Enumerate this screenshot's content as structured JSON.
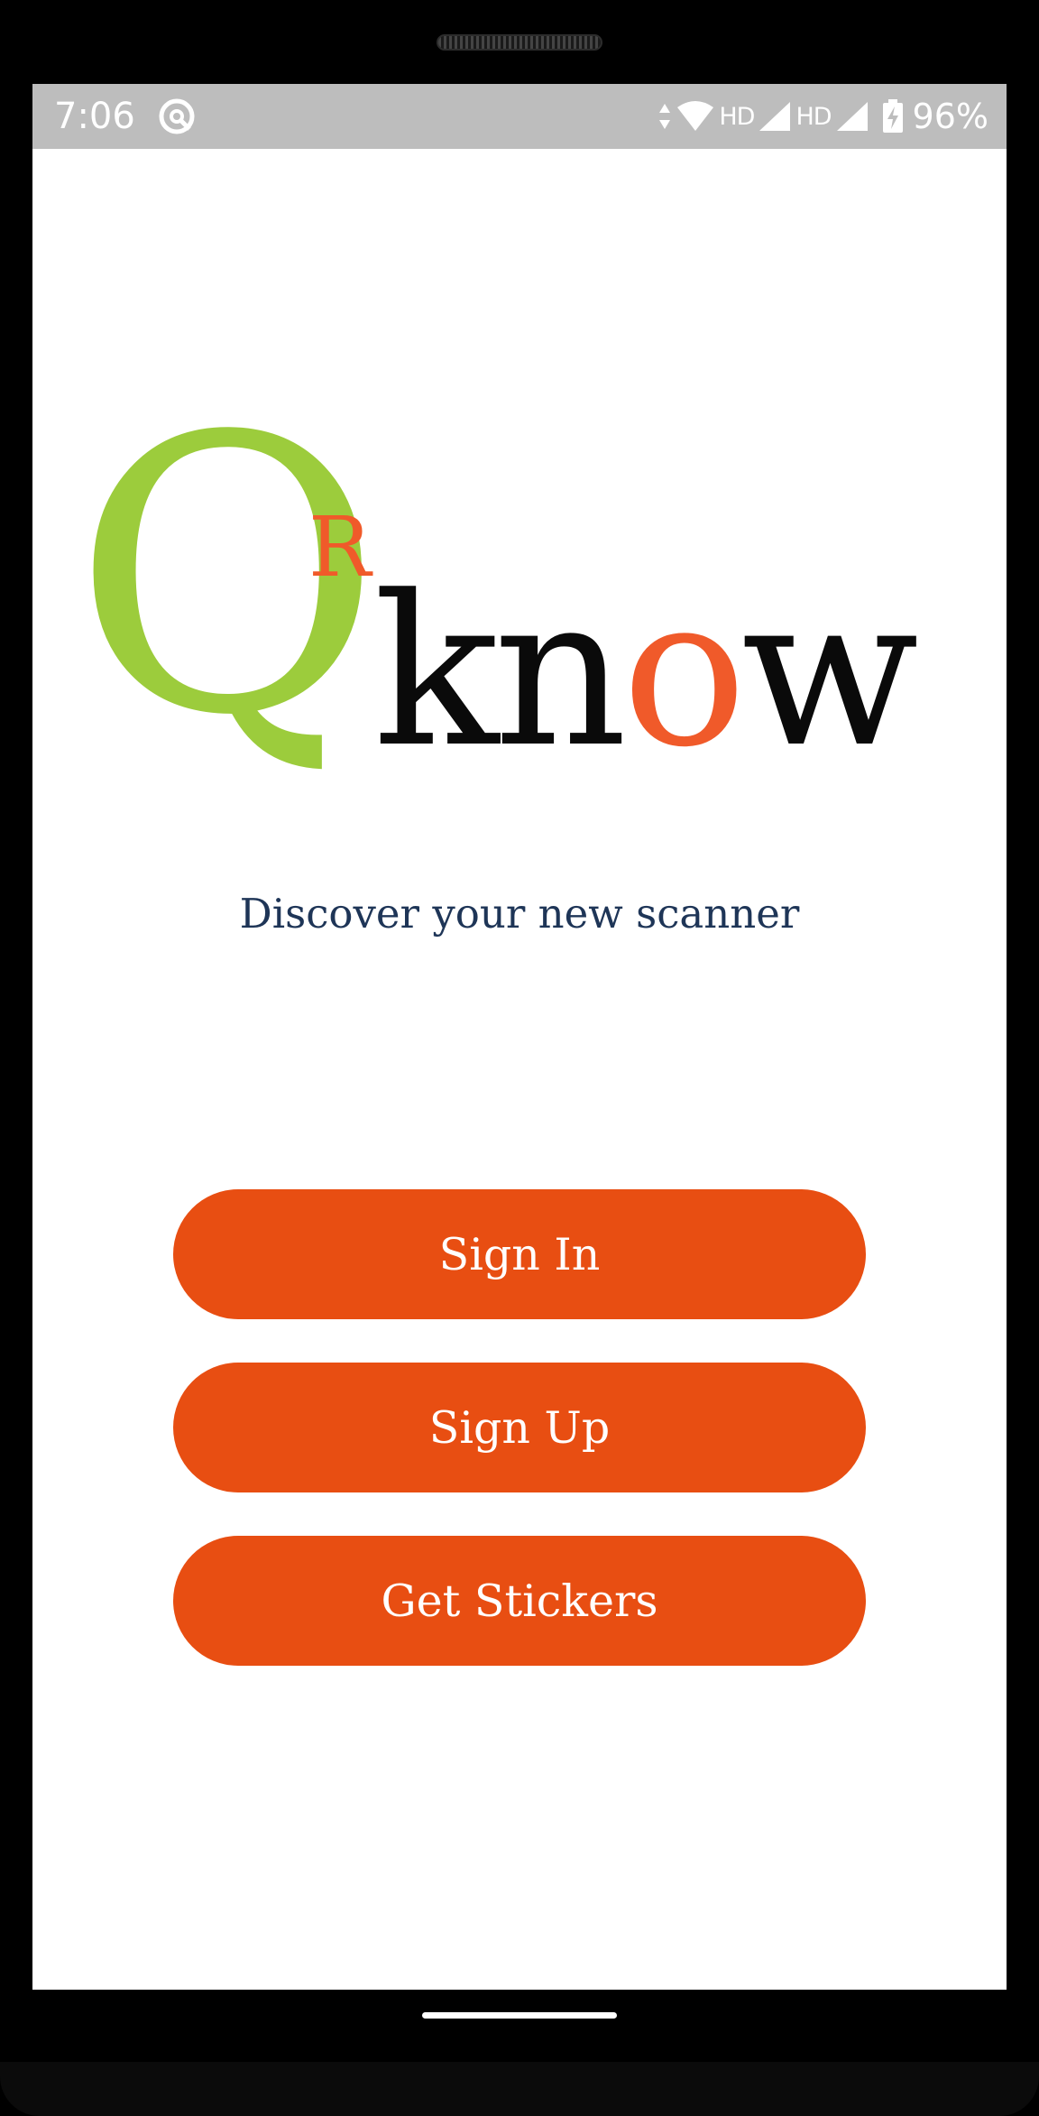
{
  "status_bar": {
    "time": "7:06",
    "network_1": "HD",
    "network_2": "HD",
    "battery": "96%",
    "icons": [
      "app-notification-icon",
      "data-arrows-icon",
      "wifi-icon",
      "signal-icon",
      "signal-icon",
      "battery-charging-icon"
    ]
  },
  "logo": {
    "q": "Q",
    "r": "R",
    "k": "k",
    "n": "n",
    "o": "o",
    "w": "w",
    "colors": {
      "green": "#9ccc3c",
      "orange": "#f05a2a",
      "black": "#0a0a0a"
    }
  },
  "tagline": "Discover your new scanner",
  "buttons": {
    "sign_in": "Sign In",
    "sign_up": "Sign Up",
    "get_stickers": "Get Stickers"
  },
  "colors": {
    "accent": "#e84e12",
    "status_bar_bg": "#bdbdbd",
    "tagline": "#1e3557"
  }
}
